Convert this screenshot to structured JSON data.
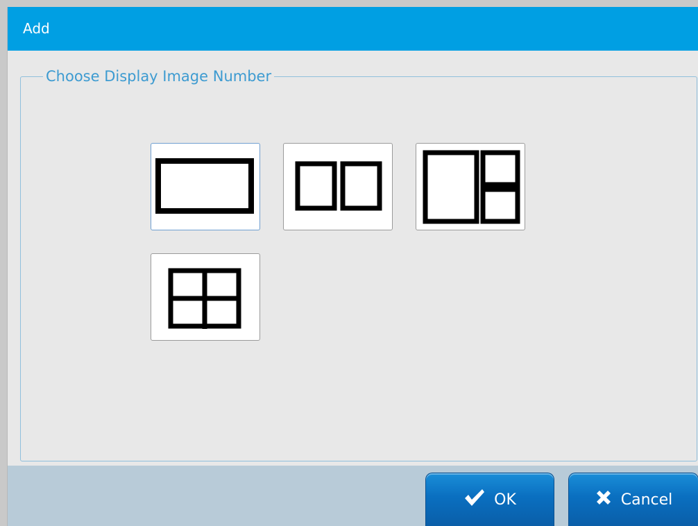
{
  "dialog": {
    "title": "Add"
  },
  "group": {
    "legend": "Choose Display Image Number"
  },
  "layouts": [
    {
      "id": "single",
      "icon": "single-pane-layout-icon",
      "selected": true
    },
    {
      "id": "two-side-by-side",
      "icon": "two-pane-layout-icon",
      "selected": false
    },
    {
      "id": "one-large-two-small",
      "icon": "three-pane-layout-icon",
      "selected": false
    },
    {
      "id": "quad",
      "icon": "four-pane-grid-layout-icon",
      "selected": false
    }
  ],
  "footer": {
    "ok_label": "OK",
    "cancel_label": "Cancel",
    "ok_icon": "checkmark-icon",
    "cancel_icon": "close-x-icon"
  },
  "colors": {
    "titlebar": "#009fe3",
    "legend_text": "#3d9bd1",
    "button_blue": "#0a6fc0",
    "footer_bg": "#b8cbd8"
  }
}
